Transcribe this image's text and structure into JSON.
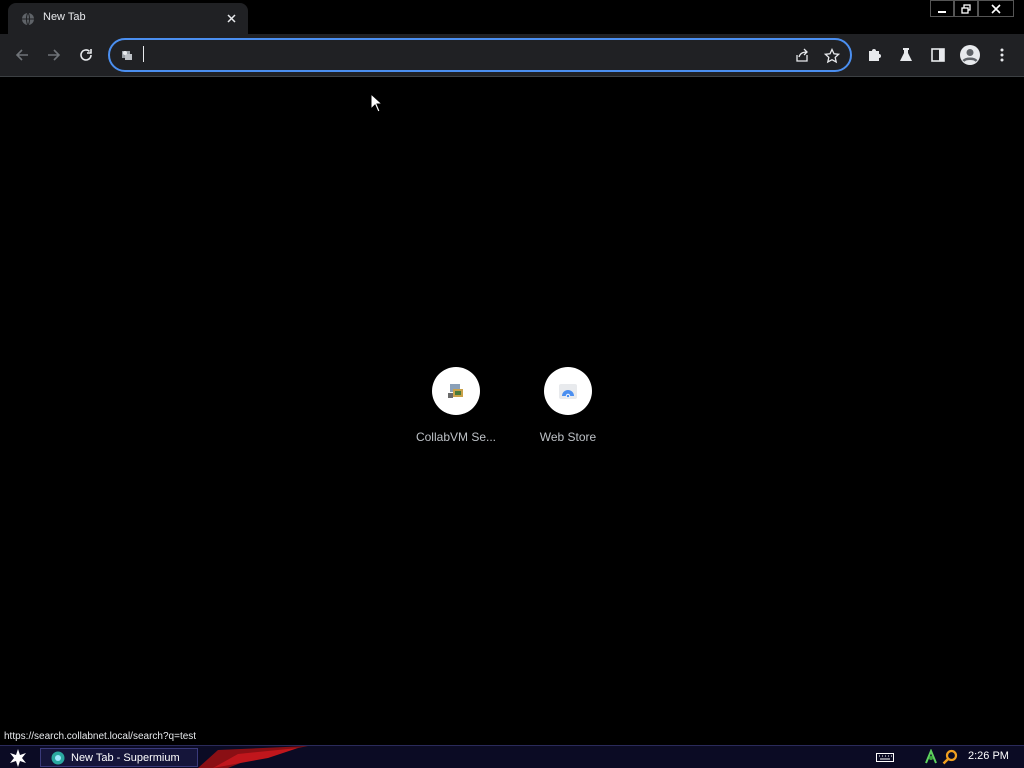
{
  "tab": {
    "title": "New Tab"
  },
  "omnibox": {
    "value": "",
    "placeholder": ""
  },
  "shortcuts": [
    {
      "label": "CollabVM Se..."
    },
    {
      "label": "Web Store"
    }
  ],
  "status_bar": {
    "url": "https://search.collabnet.local/search?q=test"
  },
  "taskbar": {
    "task_label": "New Tab - Supermium",
    "clock": "2:26 PM"
  },
  "colors": {
    "accent": "#4b8ff0",
    "toolbar": "#202124",
    "background": "#000000"
  }
}
